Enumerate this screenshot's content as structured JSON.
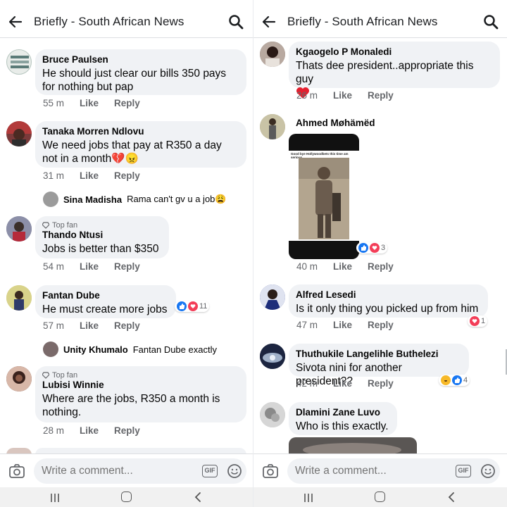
{
  "left": {
    "appbar": {
      "title": "Briefly - South African News"
    },
    "comments": [
      {
        "author": "Bruce Paulsen",
        "text": "He should just clear our bills 350 pays for nothing but pap",
        "time": "55 m",
        "like": "Like",
        "reply": "Reply"
      },
      {
        "author": "Tanaka Morren Ndlovu",
        "text": "We need jobs that pay at R350 a day not in a month💔😠",
        "time": "31 m",
        "like": "Like",
        "reply": "Reply"
      },
      {
        "author": "Thando Ntusi",
        "badge": "Top fan",
        "text": "Jobs is better than $350",
        "time": "54 m",
        "like": "Like",
        "reply": "Reply"
      },
      {
        "author": "Fantan Dube",
        "text": "He must create more jobs",
        "time": "57 m",
        "like": "Like",
        "reply": "Reply",
        "reactions": "11"
      },
      {
        "author": "Lubisi Winnie",
        "badge": "Top fan",
        "text": "Where are the jobs, R350 a month is nothing.",
        "time": "28 m",
        "like": "Like",
        "reply": "Reply"
      }
    ],
    "replies": [
      {
        "author": "Sina Madisha",
        "text": "Rama can't gv u a job😩"
      },
      {
        "author": "Unity Khumalo",
        "text": "Fantan Dube exactly"
      }
    ],
    "composer": {
      "placeholder": "Write a comment..."
    }
  },
  "right": {
    "appbar": {
      "title": "Briefly - South African News"
    },
    "comments": [
      {
        "author": "Kgaogelo P Monaledi",
        "text": "Thats dee president..appropriate this guy",
        "time": "26 m",
        "like": "Like",
        "reply": "Reply"
      },
      {
        "author": "Ahmed Møhämëd",
        "time": "40 m",
        "like": "Like",
        "reply": "Reply",
        "reactions": "3",
        "photo_caption": "Good bye Hollywoodbets this time am serious"
      },
      {
        "author": "Alfred Lesedi",
        "text": "Is it only thing you picked up from him",
        "time": "47 m",
        "like": "Like",
        "reply": "Reply",
        "reactions": "1"
      },
      {
        "author": "Thuthukile Langelihle Buthelezi",
        "text": "Sivota nini for another president??",
        "time": "42 m",
        "like": "Like",
        "reply": "Reply",
        "reactions": "4"
      },
      {
        "author": "Dlamini Zane Luvo",
        "text": "Who is this exactly."
      }
    ],
    "composer": {
      "placeholder": "Write a comment..."
    }
  },
  "icons": {
    "gif_label": "GIF"
  },
  "colors": {
    "bubble": "#f0f2f5",
    "like_blue": "#1877f2",
    "love_red": "#f33e58",
    "meta_gray": "#65676b"
  }
}
